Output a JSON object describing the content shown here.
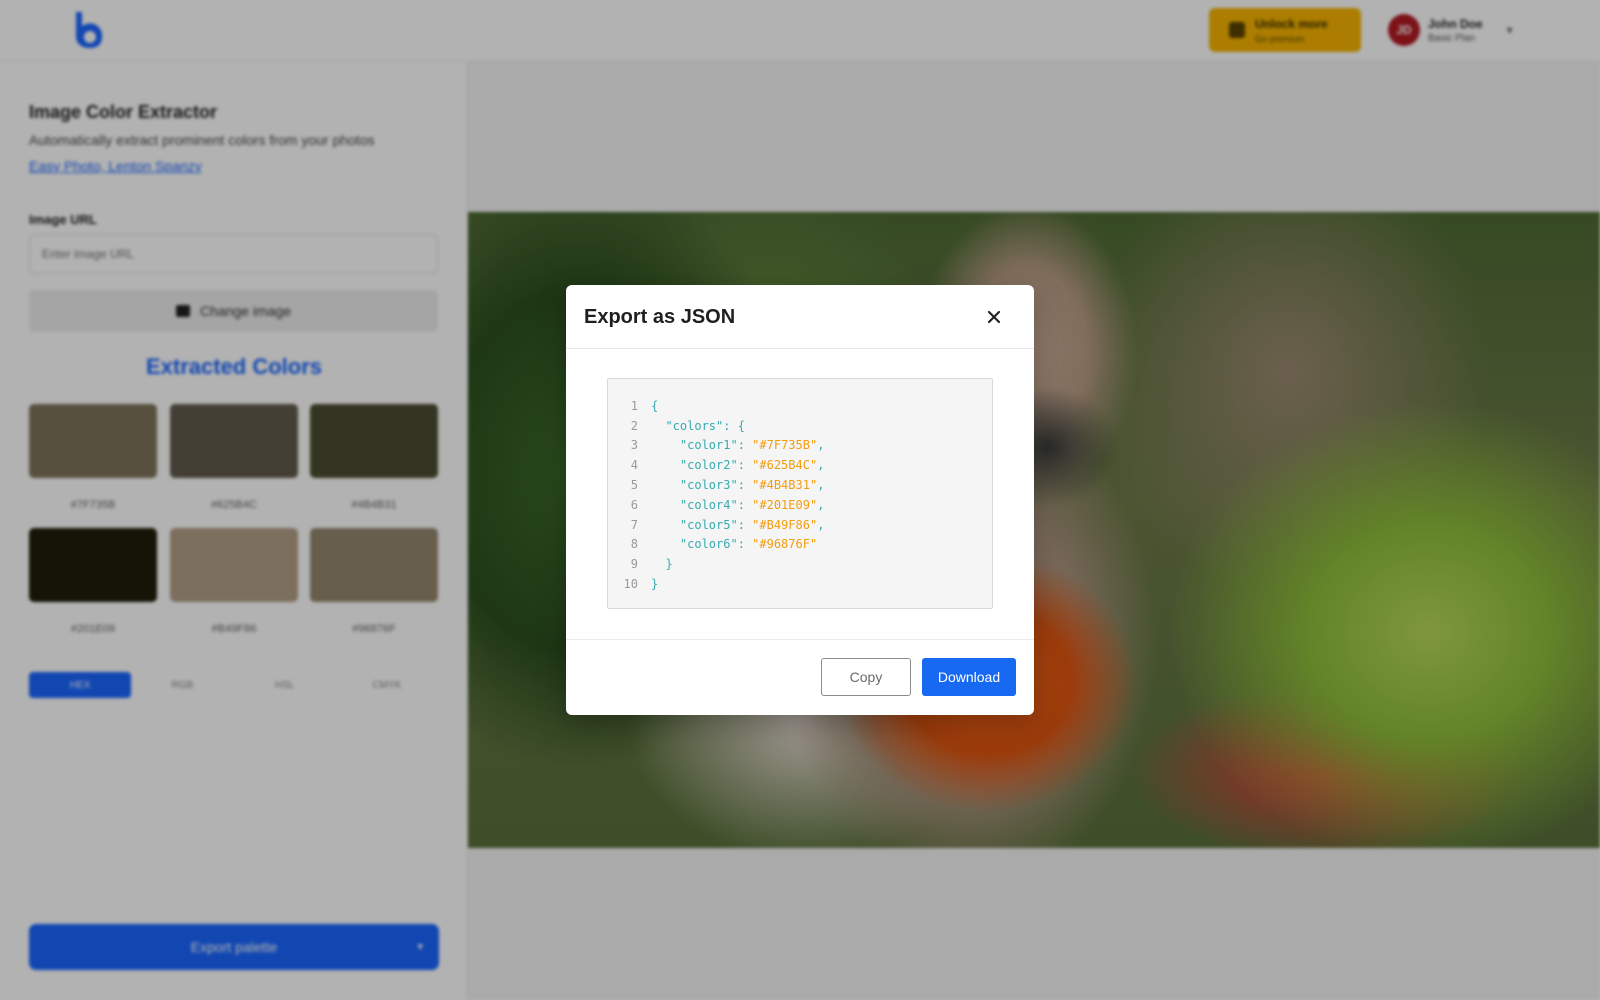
{
  "header": {
    "upgrade": {
      "title": "Unlock more",
      "subtitle": "Go premium",
      "icon": "crown-icon"
    },
    "user": {
      "initials": "JD",
      "name": "John Doe",
      "plan": "Basic Plan"
    }
  },
  "sidebar": {
    "title": "Image Color Extractor",
    "description": "Automatically extract prominent colors from your photos",
    "credit": "Easy Photo, Lenton Spanzy",
    "image_url_label": "Image URL",
    "image_url_placeholder": "Enter image URL",
    "change_image_label": "Change image",
    "extracted_heading": "Extracted Colors",
    "swatches": [
      {
        "label": "#7F735B",
        "color": "#7F735B"
      },
      {
        "label": "#625B4C",
        "color": "#625B4C"
      },
      {
        "label": "#4B4B31",
        "color": "#4B4B31"
      },
      {
        "label": "#201E09",
        "color": "#201E09"
      },
      {
        "label": "#B49F86",
        "color": "#B49F86"
      },
      {
        "label": "#96876F",
        "color": "#96876F"
      }
    ],
    "format_tabs": [
      "HEX",
      "RGB",
      "HSL",
      "CMYK"
    ],
    "active_format": "HEX",
    "export_label": "Export palette"
  },
  "modal": {
    "title": "Export as JSON",
    "line_numbers": [
      "1",
      "2",
      "3",
      "4",
      "5",
      "6",
      "7",
      "8",
      "9",
      "10"
    ],
    "colors": [
      {
        "key": "\"color1\"",
        "value": "\"#7F735B\""
      },
      {
        "key": "\"color2\"",
        "value": "\"#625B4C\""
      },
      {
        "key": "\"color3\"",
        "value": "\"#4B4B31\""
      },
      {
        "key": "\"color4\"",
        "value": "\"#201E09\""
      },
      {
        "key": "\"color5\"",
        "value": "\"#B49F86\""
      },
      {
        "key": "\"color6\"",
        "value": "\"#96876F\""
      }
    ],
    "code": {
      "open_brace": "{",
      "colors_key": "\"colors\"",
      "colon_open": ": {",
      "colon": ": ",
      "comma": ",",
      "inner_close": "}",
      "close_brace": "}"
    },
    "copy_label": "Copy",
    "download_label": "Download",
    "close_icon": "close-icon"
  },
  "colors": {
    "primary": "#1769F2",
    "accent_orange": "#F29D0E",
    "code_key": "#39A9B0",
    "upgrade_yellow": "#F6B400"
  }
}
